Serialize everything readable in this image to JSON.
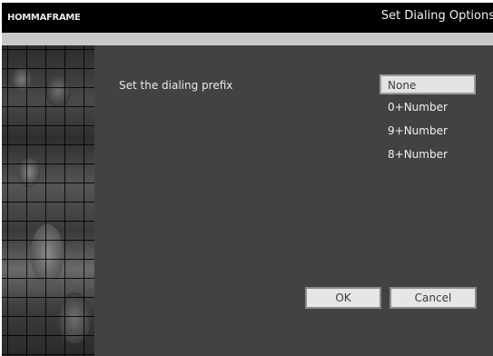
{
  "header": {
    "logo_text": "HOMMAFRAME",
    "title": "Set Dialing Options"
  },
  "main": {
    "prompt": "Set the dialing prefix",
    "options": [
      {
        "label": "None",
        "selected": true
      },
      {
        "label": "0+Number",
        "selected": false
      },
      {
        "label": "9+Number",
        "selected": false
      },
      {
        "label": "8+Number",
        "selected": false
      }
    ],
    "ok_label": "OK",
    "cancel_label": "Cancel"
  },
  "colors": {
    "titlebar": "#000000",
    "stripe": "#c9c9c9",
    "panel": "#424242",
    "selected_option": "#e3e3e3"
  }
}
